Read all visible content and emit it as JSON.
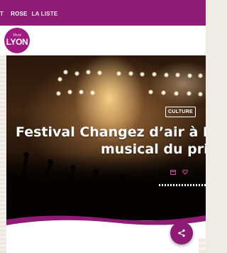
{
  "topbar": {
    "nav_items": [
      "T",
      "ROSE",
      "LA LISTE"
    ]
  },
  "logo": {
    "line1": "Vivre",
    "line2": "LYON"
  },
  "hero": {
    "category": "CULTURE",
    "title_line1": "Festival Changez d’air à Ly",
    "title_line2": "musical du pri",
    "icons": [
      "calendar-icon",
      "heart-icon"
    ]
  },
  "share": {
    "icon": "share-icon"
  },
  "colors": {
    "brand": "#8e1b74",
    "logo": "#a11a82"
  }
}
